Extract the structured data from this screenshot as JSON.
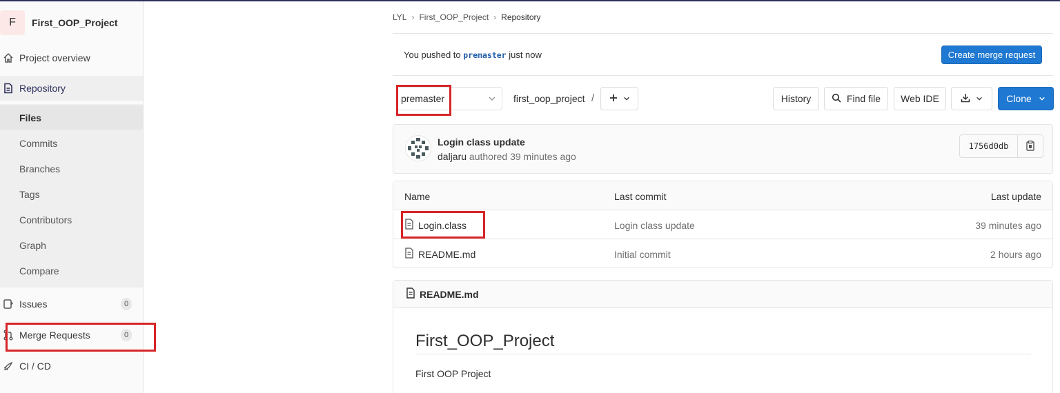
{
  "project": {
    "avatar_letter": "F",
    "name": "First_OOP_Project"
  },
  "sidebar": {
    "overview": "Project overview",
    "repository": "Repository",
    "sub_items": [
      "Files",
      "Commits",
      "Branches",
      "Tags",
      "Contributors",
      "Graph",
      "Compare"
    ],
    "issues": {
      "label": "Issues",
      "count": "0"
    },
    "merge_requests": {
      "label": "Merge Requests",
      "count": "0"
    },
    "cicd": "CI / CD"
  },
  "breadcrumb": [
    "LYL",
    "First_OOP_Project",
    "Repository"
  ],
  "push_notice": {
    "prefix": "You pushed to",
    "branch": "premaster",
    "suffix": "just now",
    "button": "Create merge request"
  },
  "toolbar": {
    "branch": "premaster",
    "path": "first_oop_project",
    "path_sep": "/",
    "history": "History",
    "find_file": "Find file",
    "web_ide": "Web IDE",
    "clone": "Clone"
  },
  "last_commit": {
    "title": "Login class update",
    "author": "daljaru",
    "meta": "authored 39 minutes ago",
    "sha": "1756d0db"
  },
  "file_table": {
    "headers": {
      "name": "Name",
      "last_commit": "Last commit",
      "last_update": "Last update"
    },
    "rows": [
      {
        "name": "Login.class",
        "commit": "Login class update",
        "updated": "39 minutes ago"
      },
      {
        "name": "README.md",
        "commit": "Initial commit",
        "updated": "2 hours ago"
      }
    ]
  },
  "readme": {
    "filename": "README.md",
    "heading": "First_OOP_Project",
    "body": "First OOP Project"
  },
  "colors": {
    "accent": "#1f78d1",
    "highlight": "#d62528",
    "nav_dark": "#2d2f5c"
  }
}
